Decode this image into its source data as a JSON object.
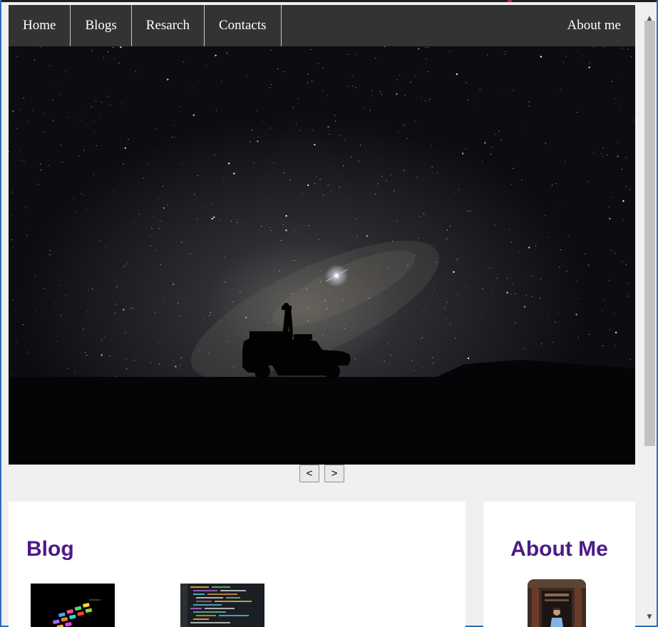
{
  "nav": {
    "links": [
      "Home",
      "Blogs",
      "Resarch",
      "Contacts"
    ],
    "right_link": "About me"
  },
  "slider": {
    "prev_label": "<",
    "next_label": ">"
  },
  "blog": {
    "title": "Blog"
  },
  "about": {
    "title": "About Me"
  },
  "scrollbar": {
    "up_glyph": "▲",
    "down_glyph": "▼"
  },
  "colors": {
    "nav_bg": "#333333",
    "heading": "#4b1a87",
    "page_bg": "#f0f0f0"
  }
}
